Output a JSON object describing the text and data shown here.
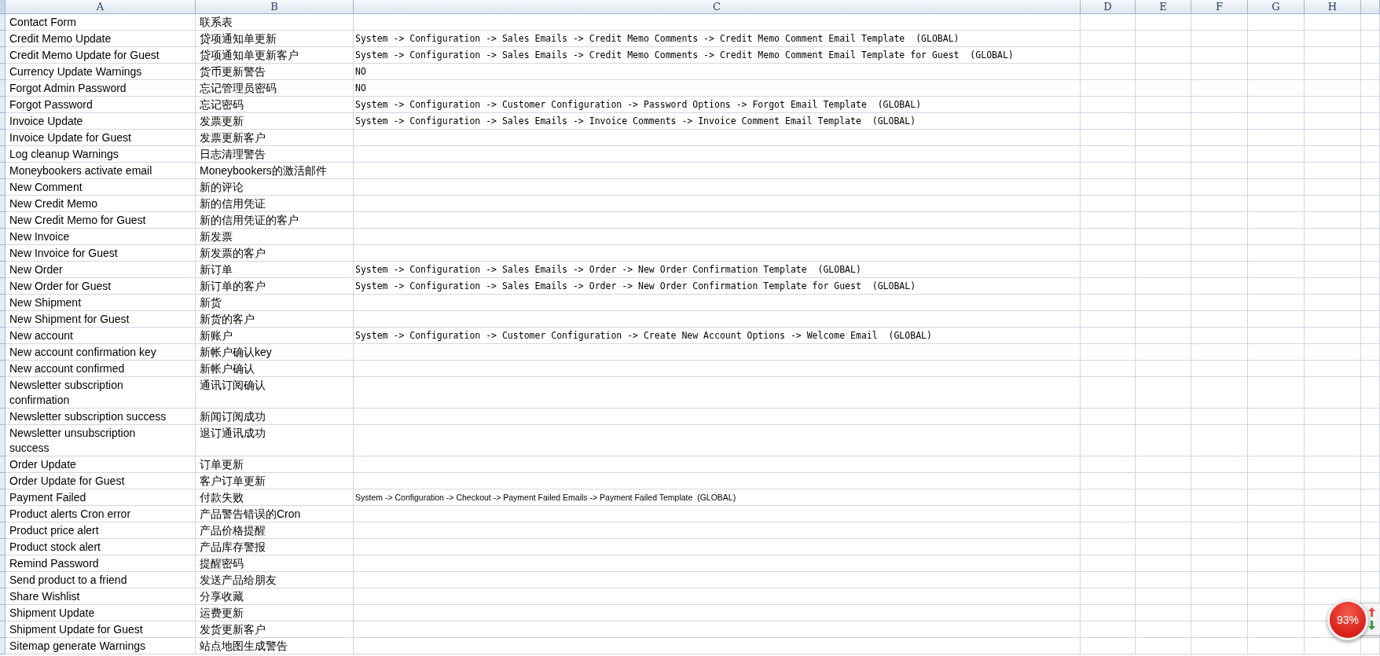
{
  "columns": [
    "A",
    "B",
    "C",
    "D",
    "E",
    "F",
    "G",
    "H"
  ],
  "rows": [
    {
      "a": "Contact Form",
      "b": "联系表"
    },
    {
      "a": "Credit Memo Update",
      "b": "贷项通知单更新",
      "c": {
        "text": "System -> Configuration -> Sales Emails -> Credit Memo Comments -> Credit Memo Comment Email Template  (GLOBAL)",
        "kind": "mono"
      }
    },
    {
      "a": "Credit Memo Update for Guest",
      "b": "贷项通知单更新客户",
      "c": {
        "text": "System -> Configuration -> Sales Emails -> Credit Memo Comments -> Credit Memo Comment Email Template for Guest  (GLOBAL)",
        "kind": "mono"
      }
    },
    {
      "a": "Currency Update Warnings",
      "b": "货币更新警告",
      "c": {
        "text": "NO",
        "kind": "mono"
      }
    },
    {
      "a": "Forgot Admin Password",
      "b": "忘记管理员密码",
      "c": {
        "text": "NO",
        "kind": "mono"
      }
    },
    {
      "a": "Forgot Password",
      "b": "忘记密码",
      "c": {
        "text": "System -> Configuration -> Customer Configuration -> Password Options -> Forgot Email Template  (GLOBAL)",
        "kind": "mono"
      }
    },
    {
      "a": "Invoice Update",
      "b": "发票更新",
      "c": {
        "text": "System -> Configuration -> Sales Emails -> Invoice Comments -> Invoice Comment Email Template  (GLOBAL)",
        "kind": "mono"
      }
    },
    {
      "a": "Invoice Update for Guest",
      "b": "发票更新客户"
    },
    {
      "a": "Log cleanup Warnings",
      "b": "日志清理警告"
    },
    {
      "a": "Moneybookers activate email",
      "b": "Moneybookers的激活邮件"
    },
    {
      "a": "New Comment",
      "b": "新的评论"
    },
    {
      "a": "New Credit Memo",
      "b": "新的信用凭证"
    },
    {
      "a": "New Credit Memo for Guest",
      "b": "新的信用凭证的客户"
    },
    {
      "a": "New Invoice",
      "b": "新发票"
    },
    {
      "a": "New Invoice for Guest",
      "b": "新发票的客户"
    },
    {
      "a": "New Order",
      "b": "新订单",
      "c": {
        "text": "System -> Configuration -> Sales Emails -> Order -> New Order Confirmation Template  (GLOBAL)",
        "kind": "mono"
      }
    },
    {
      "a": "New Order for Guest",
      "b": "新订单的客户",
      "c": {
        "text": "System -> Configuration -> Sales Emails -> Order -> New Order Confirmation Template for Guest  (GLOBAL)",
        "kind": "mono"
      }
    },
    {
      "a": "New Shipment",
      "b": "新货"
    },
    {
      "a": "New Shipment for Guest",
      "b": "新货的客户"
    },
    {
      "a": "New account",
      "b": "新账户",
      "c": {
        "text": "System -> Configuration -> Customer Configuration -> Create New Account Options -> Welcome Email  (GLOBAL)",
        "kind": "mono"
      }
    },
    {
      "a": "New account confirmation key",
      "b": "新帐户确认key"
    },
    {
      "a": "New account confirmed",
      "b": "新帐户确认"
    },
    {
      "a": "Newsletter subscription\nconfirmation",
      "b": "通讯订阅确认"
    },
    {
      "a": "Newsletter subscription success",
      "b": "新闻订阅成功"
    },
    {
      "a": "Newsletter unsubscription\nsuccess",
      "b": "退订通讯成功"
    },
    {
      "a": "Order Update",
      "b": "订单更新"
    },
    {
      "a": "Order Update for Guest",
      "b": "客户订单更新"
    },
    {
      "a": "Payment Failed",
      "b": "付款失败",
      "c": {
        "text": "System -> Configuration -> Checkout -> Payment Failed Emails -> Payment Failed Template  (GLOBAL)",
        "kind": "sans"
      }
    },
    {
      "a": "Product alerts Cron error",
      "b": "产品警告错误的Cron"
    },
    {
      "a": "Product price alert",
      "b": "产品价格提醒"
    },
    {
      "a": "Product stock alert",
      "b": "产品库存警报"
    },
    {
      "a": "Remind Password",
      "b": "提醒密码"
    },
    {
      "a": "Send product to a friend",
      "b": "发送产品给朋友"
    },
    {
      "a": "Share Wishlist",
      "b": "分享收藏"
    },
    {
      "a": "Shipment Update",
      "b": "运费更新"
    },
    {
      "a": "Shipment Update for Guest",
      "b": "发货更新客户"
    },
    {
      "a": "Sitemap generate Warnings",
      "b": "站点地图生成警告"
    }
  ],
  "zoom_badge": {
    "label": "93%"
  }
}
